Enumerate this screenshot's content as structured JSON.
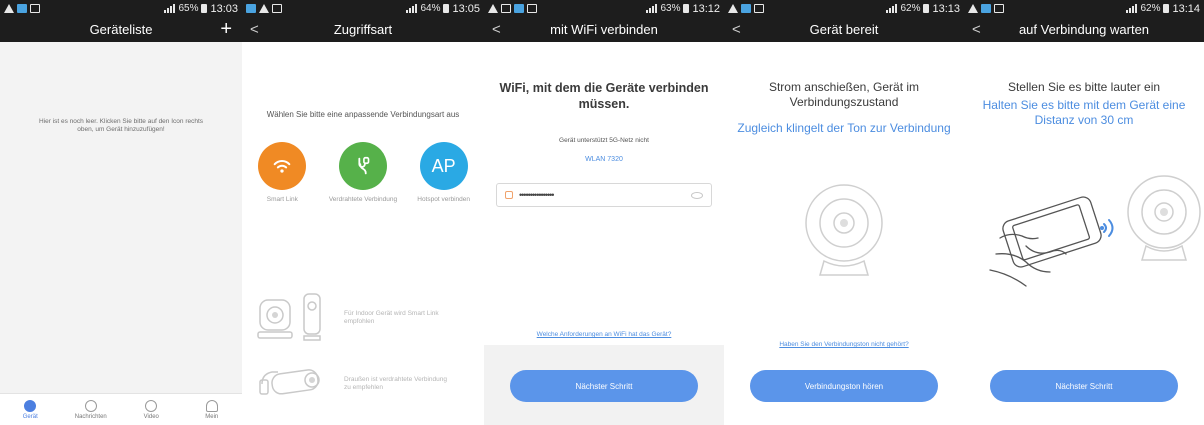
{
  "status": {
    "s1": {
      "time": "13:03",
      "battery": "65%"
    },
    "s2": {
      "time": "13:05",
      "battery": "64%"
    },
    "s3": {
      "time": "13:12",
      "battery": "63%"
    },
    "s4": {
      "time": "13:13",
      "battery": "62%"
    },
    "s5": {
      "time": "13:14",
      "battery": "62%"
    }
  },
  "screen1": {
    "title": "Geräteliste",
    "add": "+",
    "empty": "Hier ist es noch leer. Klicken Sie bitte auf den Icon rechts oben, um Gerät hinzuzufügen!",
    "tabs": [
      {
        "label": "Gerät"
      },
      {
        "label": "Nachrichten"
      },
      {
        "label": "Video"
      },
      {
        "label": "Mein"
      }
    ]
  },
  "screen2": {
    "title": "Zugriffsart",
    "back": "<",
    "hint": "Wählen Sie bitte eine anpassende Verbindungsart aus",
    "modes": [
      {
        "label": "Smart Link",
        "color": "#f08a24"
      },
      {
        "label": "Verdrahtete Verbindung",
        "color": "#56b14a"
      },
      {
        "label": "Hotspot verbinden",
        "icon_text": "AP",
        "color": "#2aa9e4"
      }
    ],
    "rec1": "Für Indoor Gerät wird Smart Link empfohlen",
    "rec2": "Draußen ist verdrahtete Verbindung zu empfehlen"
  },
  "screen3": {
    "title": "mit WiFi verbinden",
    "back": "<",
    "heading": "WiFi, mit dem die Geräte verbinden müssen.",
    "note": "Gerät unterstützt 5G-Netz nicht",
    "ssid": "WLAN 7320",
    "password_mask": "••••••••••••••••",
    "link": "Welche Anforderungen an WiFi hat das Gerät?",
    "button": "Nächster Schritt"
  },
  "screen4": {
    "title": "Gerät bereit",
    "back": "<",
    "line1": "Strom anschießen, Gerät im Verbindungszustand",
    "line2": "Zugleich klingelt der Ton zur Verbindung",
    "link": "Haben Sie den Verbindungston nicht gehört?",
    "button": "Verbindungston hören"
  },
  "screen5": {
    "title": "auf Verbindung warten",
    "back": "<",
    "line1": "Stellen Sie es bitte lauter ein",
    "line2a": "Halten Sie es bitte mit dem Gerät eine",
    "line2b": "Distanz von 30 cm",
    "button": "Nächster Schritt"
  },
  "colors": {
    "accent": "#4c8de0",
    "button": "#5b95ea",
    "bar": "#1d1d1d"
  }
}
